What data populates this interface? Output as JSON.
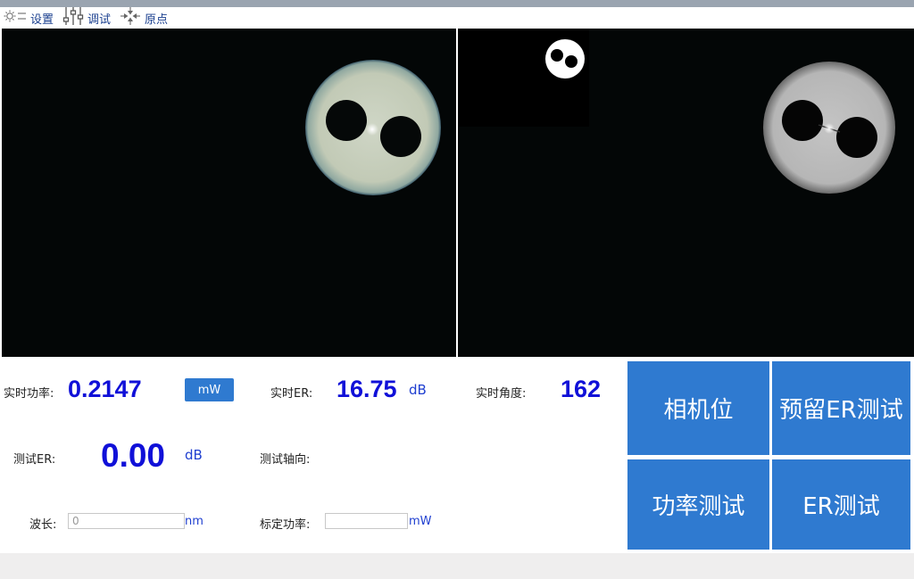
{
  "toolbar": {
    "settings_label": "设置",
    "debug_label": "调试",
    "origin_label": "原点"
  },
  "readouts": {
    "power_label": "实时功率:",
    "power_value": "0.2147",
    "power_unit_button": "mW",
    "er_label": "实时ER:",
    "er_value": "16.75",
    "er_unit": "dB",
    "angle_label": "实时角度:",
    "angle_value": "162",
    "test_er_label": "测试ER:",
    "test_er_value": "0.00",
    "test_er_unit": "dB",
    "test_axis_label": "测试轴向:"
  },
  "inputs": {
    "wavelength_label": "波长:",
    "wavelength_value": "0",
    "wavelength_unit": "nm",
    "cal_power_label": "标定功率:",
    "cal_power_value": "",
    "cal_power_unit": "mW"
  },
  "buttons": {
    "camera_position": "相机位",
    "reserve_er_test": "预留ER测试",
    "power_test": "功率测试",
    "er_test": "ER测试"
  },
  "colors": {
    "accent_blue": "#2f7ad0",
    "value_blue": "#1010d8",
    "view_background": "#030606"
  }
}
